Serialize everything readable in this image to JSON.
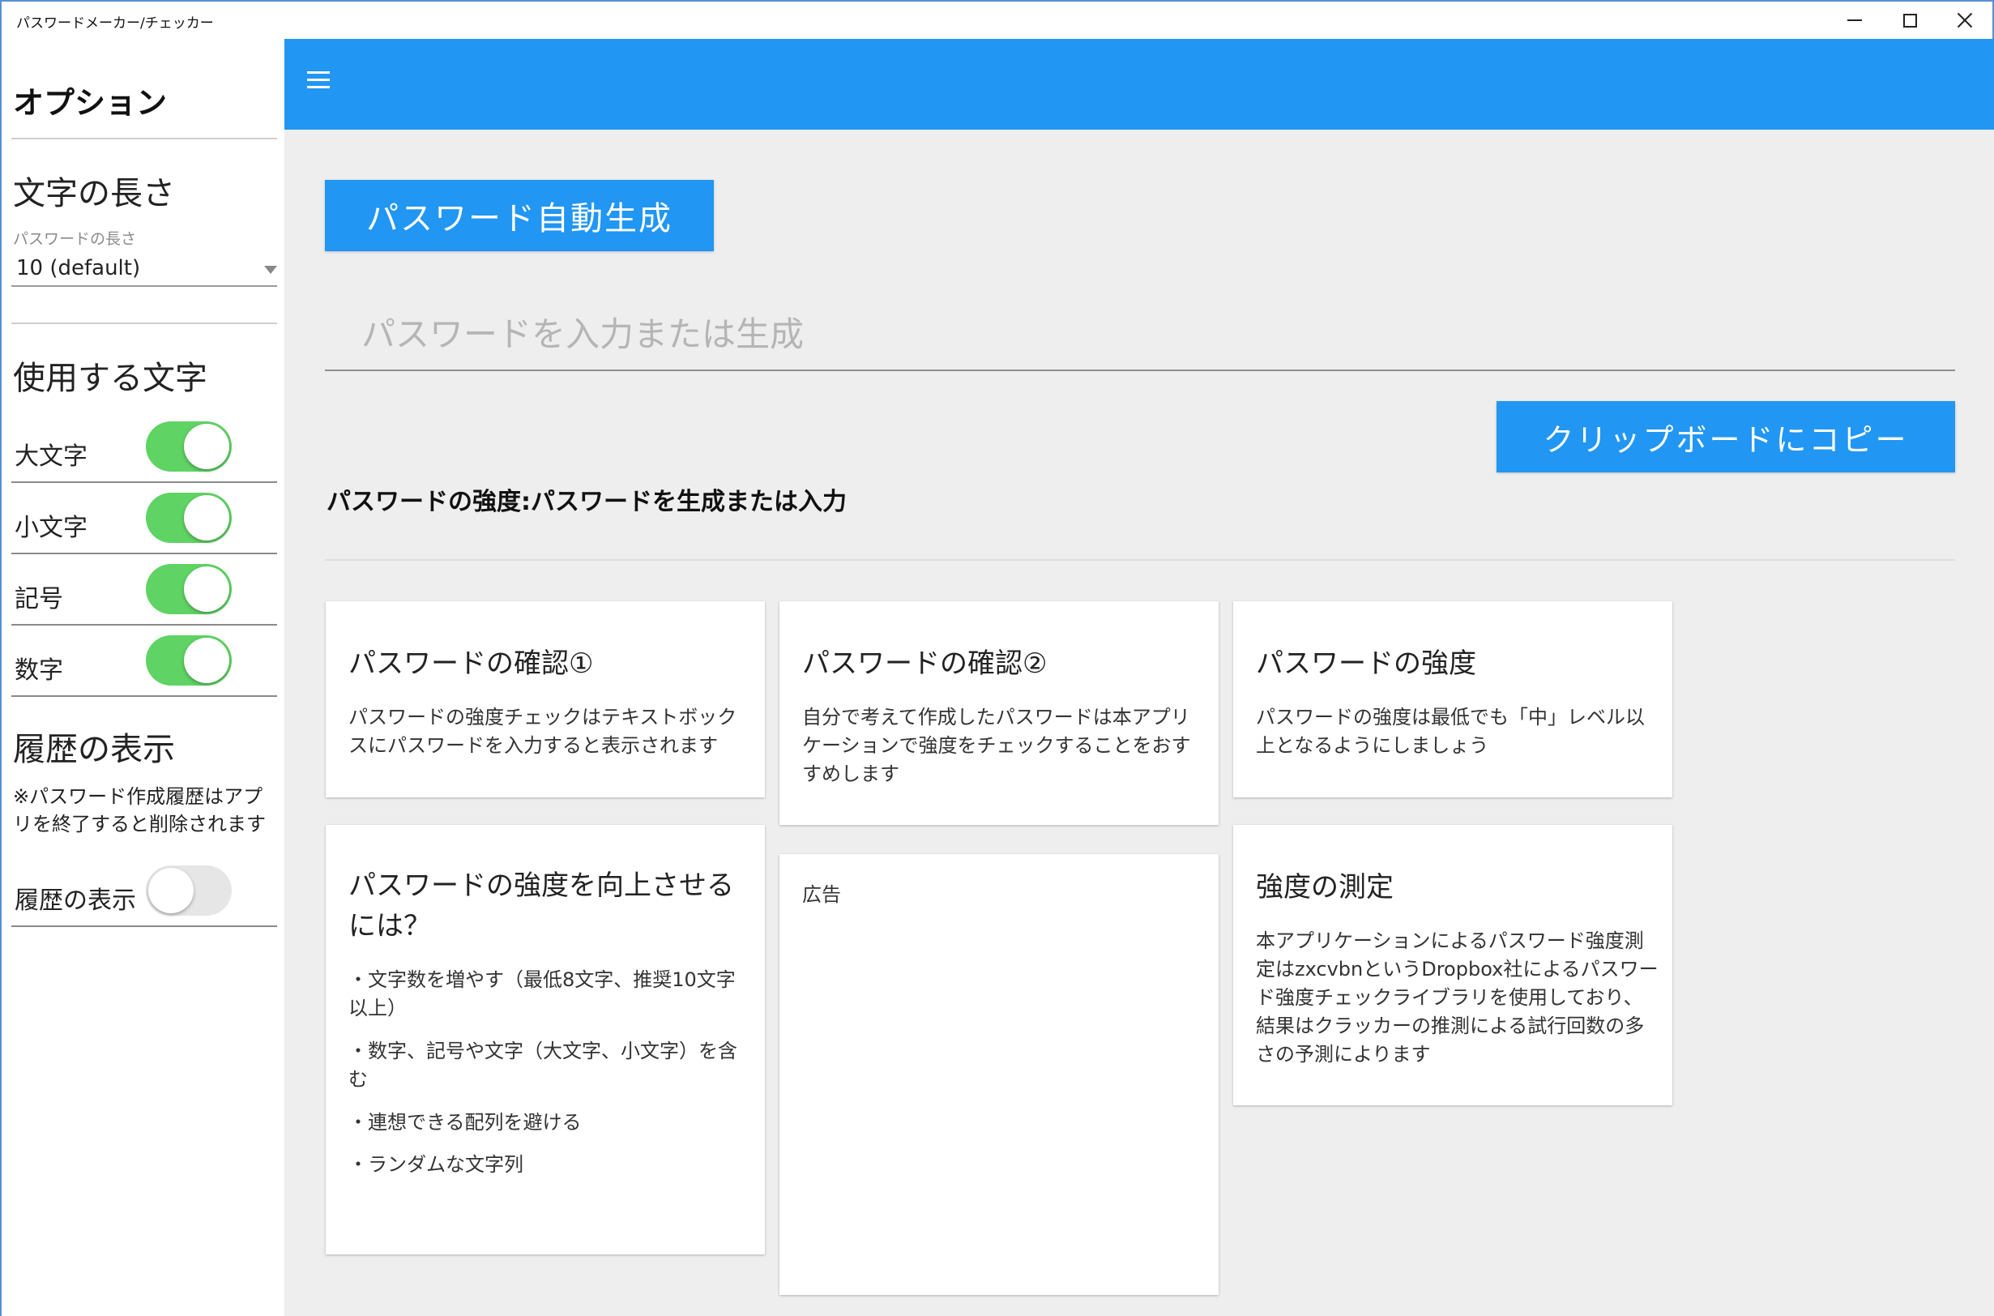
{
  "window": {
    "title": "パスワードメーカー/チェッカー"
  },
  "sidebar": {
    "heading": "オプション",
    "length_section": "文字の長さ",
    "length_caption": "パスワードの長さ",
    "length_value": "10 (default)",
    "chars_section": "使用する文字",
    "toggles": [
      {
        "label": "大文字",
        "on": true
      },
      {
        "label": "小文字",
        "on": true
      },
      {
        "label": "記号",
        "on": true
      },
      {
        "label": "数字",
        "on": true
      }
    ],
    "history_section": "履歴の表示",
    "history_note": "※パスワード作成履歴はアプリを終了すると削除されます",
    "history_toggle": {
      "label": "履歴の表示",
      "on": false
    }
  },
  "main": {
    "generate_button": "パスワード自動生成",
    "password_placeholder": "パスワードを入力または生成",
    "copy_button": "クリップボードにコピー",
    "strength_text": "パスワードの強度:パスワードを生成または入力"
  },
  "cards": {
    "check1": {
      "title": "パスワードの確認①",
      "body": [
        "パスワードの強度チェックはテキストボック",
        "スにパスワードを入力すると表示されます"
      ]
    },
    "check2": {
      "title": "パスワードの確認②",
      "body": [
        "自分で考えて作成したパスワードは本アプリ",
        "ケーションで強度をチェックすることをおす",
        "すめします"
      ]
    },
    "strength": {
      "title": "パスワードの強度",
      "body": [
        "パスワードの強度は最低でも「中」レベル以",
        "上となるようにしましょう"
      ]
    },
    "improve": {
      "title": [
        "パスワードの強度を向上させる",
        "には？"
      ],
      "items": [
        [
          "・文字数を増やす（最低8文字、推奨10文字",
          "以上）"
        ],
        [
          "・数字、記号や文字（大文字、小文字）を含",
          "む"
        ],
        [
          "・連想できる配列を避ける"
        ],
        [
          "・ランダムな文字列"
        ]
      ]
    },
    "ad": {
      "label": "広告"
    },
    "measure": {
      "title": "強度の測定",
      "body": [
        "本アプリケーションによるパスワード強度測",
        "定はzxcvbnというDropbox社によるパスワー",
        "ド強度チェックライブラリを使用しており、",
        "結果はクラッカーの推測による試行回数の多",
        "さの予測によります"
      ]
    }
  },
  "colors": {
    "accent": "#2196f3",
    "toggle_on": "#5fd363",
    "toggle_off": "#e6e6e6",
    "content_bg": "#eeeeee"
  }
}
